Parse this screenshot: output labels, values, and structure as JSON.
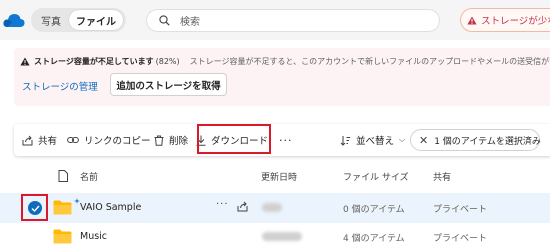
{
  "header": {
    "view_switch": {
      "photos": "写真",
      "files": "ファイル"
    },
    "search_placeholder": "検索",
    "storage_alert": "ストレージが少な"
  },
  "banner": {
    "title": "ストレージ容量が不足しています",
    "percent": "(82%)",
    "description": "ストレージ容量が不足すると、このアカウントで新しいファイルのアップロードやメールの送受信ができなくなり",
    "manage_link": "ストレージの管理",
    "add_button": "追加のストレージを取得"
  },
  "toolbar": {
    "share": "共有",
    "copy_link": "リンクのコピー",
    "delete": "削除",
    "download": "ダウンロード",
    "more": "···",
    "sort": "並べ替え",
    "selected": "1 個のアイテムを選択済み"
  },
  "table": {
    "columns": [
      "名前",
      "更新日時",
      "ファイル サイズ",
      "共有"
    ],
    "rows": [
      {
        "name": "VAIO Sample",
        "size": "0 個のアイテム",
        "sharing": "プライベート",
        "selected": true
      },
      {
        "name": "Music",
        "size": "4 個のアイテム",
        "sharing": "プライベート",
        "selected": false
      }
    ]
  },
  "colors": {
    "accent": "#0f6cbd",
    "warning": "#c4314b",
    "highlight": "#d91a2a",
    "folder": "#ffb900"
  }
}
